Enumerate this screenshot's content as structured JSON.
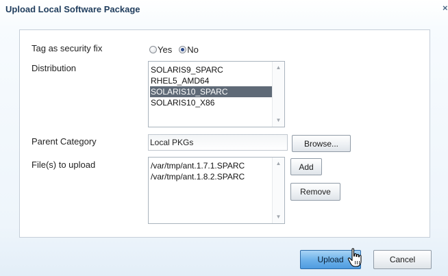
{
  "dialog": {
    "title": "Upload Local Software Package",
    "close_symbol": "×"
  },
  "form": {
    "security_fix": {
      "label": "Tag as security fix",
      "options": [
        {
          "label": "Yes",
          "checked": false
        },
        {
          "label": "No",
          "checked": true
        }
      ]
    },
    "distribution": {
      "label": "Distribution",
      "items": [
        "SOLARIS9_SPARC",
        "RHEL5_AMD64",
        "SOLARIS10_SPARC",
        "SOLARIS10_X86"
      ],
      "selected": "SOLARIS10_SPARC"
    },
    "parent_category": {
      "label": "Parent Category",
      "value": "Local PKGs",
      "browse_label": "Browse..."
    },
    "files": {
      "label": "File(s) to upload",
      "items": [
        "/var/tmp/ant.1.7.1.SPARC",
        "/var/tmp/ant.1.8.2.SPARC"
      ],
      "add_label": "Add",
      "remove_label": "Remove"
    }
  },
  "footer": {
    "upload_label": "Upload",
    "cancel_label": "Cancel"
  },
  "colors": {
    "title": "#1f3c5c",
    "selected_row": "#5f6a77",
    "primary_button": "#6fb3ea"
  },
  "icons": {
    "close": "close-icon",
    "cursor": "hand-pointer-icon",
    "scroll_up": "scroll-up-arrow-icon",
    "scroll_down": "scroll-down-arrow-icon"
  }
}
